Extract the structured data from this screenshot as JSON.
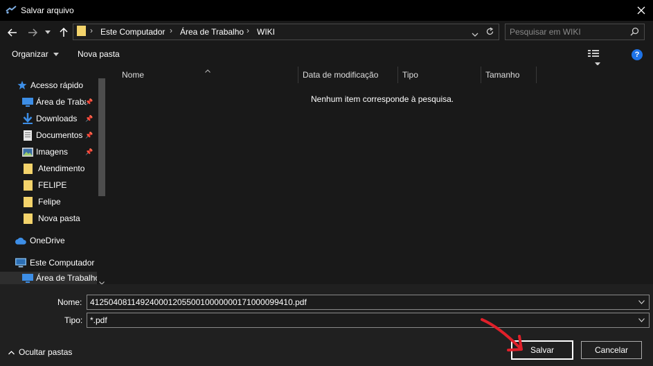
{
  "window": {
    "title": "Salvar arquivo"
  },
  "address": {
    "crumbs": [
      "Este Computador",
      "Área de Trabalho",
      "WIKI"
    ]
  },
  "search": {
    "placeholder": "Pesquisar em WIKI"
  },
  "toolbar": {
    "organize_label": "Organizar",
    "new_folder_label": "Nova pasta"
  },
  "nav": {
    "quick_access": "Acesso rápido",
    "items": [
      {
        "label": "Área de Trabalho",
        "icon": "desktop-icon",
        "pinned": true
      },
      {
        "label": "Downloads",
        "icon": "download-icon",
        "pinned": true
      },
      {
        "label": "Documentos",
        "icon": "document-icon",
        "pinned": true
      },
      {
        "label": "Imagens",
        "icon": "images-icon",
        "pinned": true
      },
      {
        "label": "Atendimento",
        "icon": "folder-icon",
        "pinned": false
      },
      {
        "label": "FELIPE",
        "icon": "folder-icon",
        "pinned": false
      },
      {
        "label": "Felipe",
        "icon": "folder-icon",
        "pinned": false
      },
      {
        "label": "Nova pasta",
        "icon": "folder-icon",
        "pinned": false
      }
    ],
    "onedrive": "OneDrive",
    "this_pc": "Este Computador",
    "this_pc_child": "Área de Trabalho"
  },
  "columns": [
    "Nome",
    "Data de modificação",
    "Tipo",
    "Tamanho"
  ],
  "empty_message": "Nenhum item corresponde à pesquisa.",
  "form": {
    "name_label": "Nome:",
    "name_value": "41250408114924000120550010000000171000099410.pdf",
    "type_label": "Tipo:",
    "type_value": "*.pdf"
  },
  "footer": {
    "hide_folders_label": "Ocultar pastas",
    "save_label": "Salvar",
    "cancel_label": "Cancelar"
  },
  "colors": {
    "accent": "#1e73e8",
    "folder": "#f3d36b",
    "annotation": "#e0202a"
  }
}
